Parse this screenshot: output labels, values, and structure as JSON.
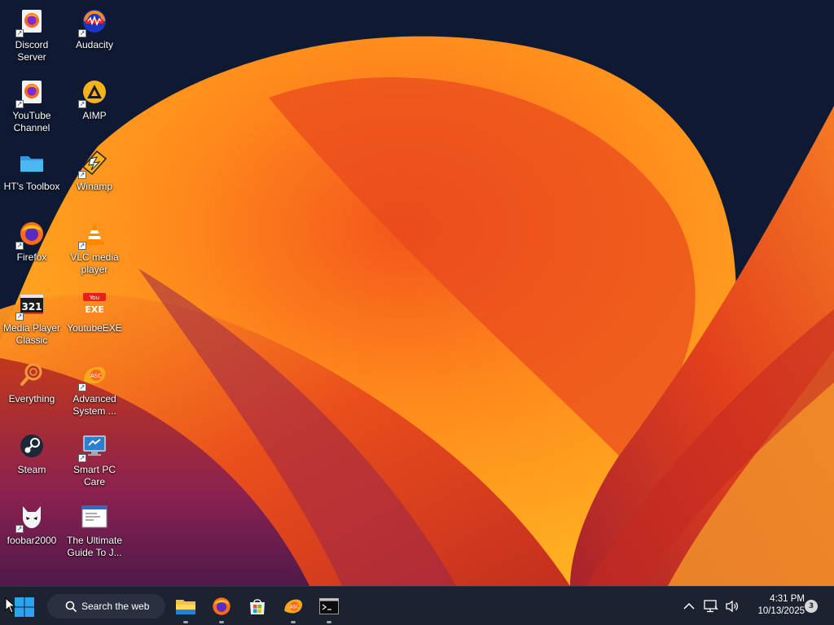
{
  "desktop": {
    "icons": [
      {
        "label": "Discord\nServer",
        "icon": "firefox-shortcut-icon"
      },
      {
        "label": "Audacity",
        "icon": "audacity-icon"
      },
      {
        "label": "YouTube\nChannel",
        "icon": "firefox-shortcut-icon"
      },
      {
        "label": "AIMP",
        "icon": "aimp-icon"
      },
      {
        "label": "HT's Toolbox",
        "icon": "folder-icon"
      },
      {
        "label": "Winamp",
        "icon": "winamp-icon"
      },
      {
        "label": "Firefox",
        "icon": "firefox-icon"
      },
      {
        "label": "VLC media\nplayer",
        "icon": "vlc-icon"
      },
      {
        "label": "Media Player\nClassic",
        "icon": "media-player-classic-icon"
      },
      {
        "label": "YoutubeEXE",
        "icon": "youtubeexe-icon"
      },
      {
        "label": "Everything",
        "icon": "everything-search-icon"
      },
      {
        "label": "Advanced\nSystem ...",
        "icon": "advanced-systemcare-icon"
      },
      {
        "label": "Steam",
        "icon": "steam-icon"
      },
      {
        "label": "Smart PC\nCare",
        "icon": "smart-pc-care-icon"
      },
      {
        "label": "foobar2000",
        "icon": "foobar2000-icon"
      },
      {
        "label": "The Ultimate\nGuide To J...",
        "icon": "document-icon"
      }
    ]
  },
  "taskbar": {
    "search_label": "Search the web",
    "apps": [
      {
        "name": "File Explorer",
        "icon": "file-explorer-icon"
      },
      {
        "name": "Firefox",
        "icon": "firefox-icon"
      },
      {
        "name": "Microsoft Store",
        "icon": "store-icon"
      },
      {
        "name": "Advanced SystemCare",
        "icon": "advanced-systemcare-icon"
      },
      {
        "name": "Command Prompt",
        "icon": "terminal-icon"
      }
    ],
    "time": "4:31 PM",
    "date": "10/13/2025",
    "notification_count": "3"
  },
  "colors": {
    "taskbar_bg": "#1c2230",
    "wallpaper_dark": "#0e1a33",
    "wallpaper_orange": "#ff8a1c",
    "wallpaper_red": "#e03a1a",
    "wallpaper_purple": "#7a1e5a"
  }
}
